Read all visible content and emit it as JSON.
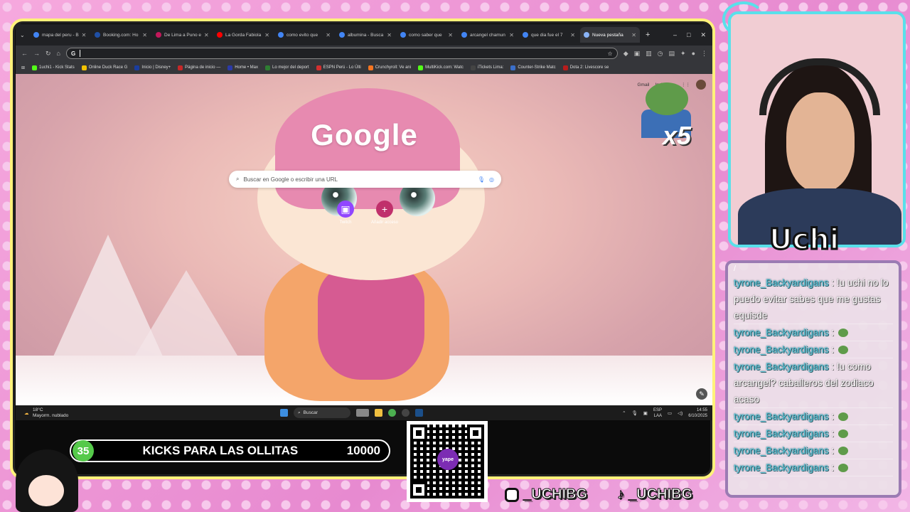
{
  "browser": {
    "tabs": [
      {
        "label": "mapa del peru - B",
        "color": "#4285f4",
        "active": false
      },
      {
        "label": "Booking.com: Ho",
        "color": "#1f4fa5",
        "active": false
      },
      {
        "label": "De Lima a Puno e",
        "color": "#c2185b",
        "active": false
      },
      {
        "label": "La Gorda Fabiola",
        "color": "#ff0000",
        "active": false
      },
      {
        "label": "como evito que",
        "color": "#4285f4",
        "active": false
      },
      {
        "label": "albumina - Busca",
        "color": "#4285f4",
        "active": false
      },
      {
        "label": "como saber que",
        "color": "#4285f4",
        "active": false
      },
      {
        "label": "arcangel chamun",
        "color": "#4285f4",
        "active": false
      },
      {
        "label": "que dia fue el 7",
        "color": "#4285f4",
        "active": false
      },
      {
        "label": "Nueva pestaña",
        "color": "#8ab4f8",
        "active": true
      }
    ],
    "new_tab": "+",
    "win": {
      "min": "–",
      "max": "□",
      "close": "✕"
    },
    "omnibox_value": "",
    "bookmarks": [
      {
        "label": "1uchi1 - Kick Stats",
        "color": "#53fc18"
      },
      {
        "label": "Online Duck Race G",
        "color": "#f2c200"
      },
      {
        "label": "Inicio | Disney+",
        "color": "#1a3d9e"
      },
      {
        "label": "Página de inicio —",
        "color": "#c62828"
      },
      {
        "label": "Home • Max",
        "color": "#2b3aa8"
      },
      {
        "label": "Lo mejor del deport",
        "color": "#2e7d32"
      },
      {
        "label": "ESPN Perú - Lo Últi",
        "color": "#d32f2f"
      },
      {
        "label": "Crunchyroll: Ve ani",
        "color": "#f47521"
      },
      {
        "label": "MultiKick.com: Watc",
        "color": "#53fc18"
      },
      {
        "label": "iTickets Lima:",
        "color": "#444444"
      },
      {
        "label": "Counter-Strike Matc",
        "color": "#3b6fc9"
      },
      {
        "label": "Dota 2: Livescore se",
        "color": "#b71c1c"
      }
    ]
  },
  "newtab": {
    "logo": "Google",
    "search_placeholder": "Buscar en Google o escribir una URL",
    "gmail": "Gmail",
    "images": "Imágenes",
    "shortcuts": [
      {
        "label": "Twitch",
        "icon": "twitch-icon",
        "color": "#9146ff",
        "glyph": "▣"
      },
      {
        "label": "Añadir acceso",
        "icon": "add-icon",
        "color": "#c0306b",
        "glyph": "+"
      }
    ],
    "edit_glyph": "✎"
  },
  "overlay_emote": {
    "multiplier": "x5"
  },
  "taskbar": {
    "temp": "18°C",
    "weather": "Mayorm. nublado",
    "search": "Buscar",
    "lang1": "ESP",
    "lang2": "LAA",
    "time": "14:55",
    "date": "6/10/2025"
  },
  "goal": {
    "count": "35",
    "label": "KICKS PARA LAS OLLITAS",
    "target": "10000"
  },
  "qr": {
    "brand": "yape"
  },
  "socials": {
    "instagram": "_UCHIBG",
    "tiktok": "_UCHIBG"
  },
  "streamer": {
    "name": "Uchi"
  },
  "chat": {
    "header": "/",
    "messages": [
      {
        "user": "tyrone_Backyardigans",
        "text": " : !u uchi no lo puedo evitar sabes que me gustas equisde",
        "emote": false
      },
      {
        "user": "tyrone_Backyardigans",
        "text": " :",
        "emote": true
      },
      {
        "user": "tyrone_Backyardigans",
        "text": " :",
        "emote": true
      },
      {
        "user": "tyrone_Backyardigans",
        "text": " : !u como arcangel? caballeros del zodiaco acaso",
        "emote": false
      },
      {
        "user": "tyrone_Backyardigans",
        "text": " :",
        "emote": true
      },
      {
        "user": "tyrone_Backyardigans",
        "text": " :",
        "emote": true
      },
      {
        "user": "tyrone_Backyardigans",
        "text": " :",
        "emote": true
      },
      {
        "user": "tyrone_Backyardigans",
        "text": " :",
        "emote": true
      }
    ]
  }
}
